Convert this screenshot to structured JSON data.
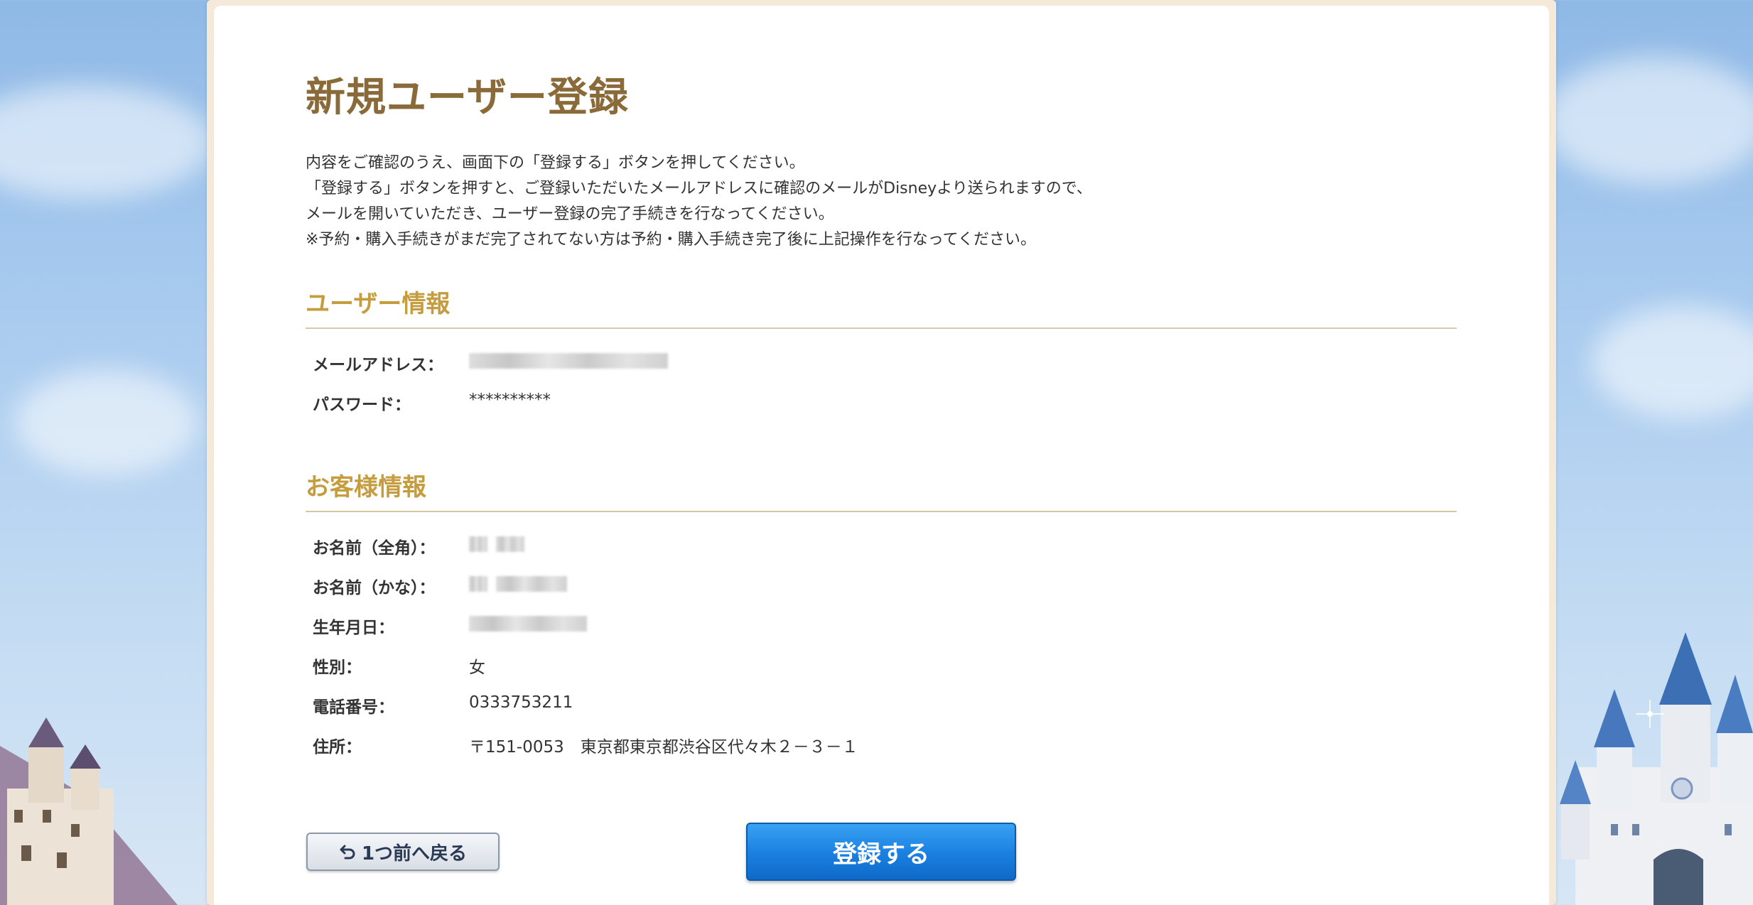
{
  "page": {
    "title": "新規ユーザー登録",
    "intro_lines": [
      "内容をご確認のうえ、画面下の「登録する」ボタンを押してください。",
      "「登録する」ボタンを押すと、ご登録いただいたメールアドレスに確認のメールがDisneyより送られますので、",
      "メールを開いていただき、ユーザー登録の完了手続きを行なってください。",
      "※予約・購入手続きがまだ完了されてない方は予約・購入手続き完了後に上記操作を行なってください。"
    ]
  },
  "user_info": {
    "heading": "ユーザー情報",
    "email_label": "メールアドレス：",
    "password_label": "パスワード：",
    "password_value": "**********"
  },
  "customer_info": {
    "heading": "お客様情報",
    "name_full_label": "お名前（全角）：",
    "name_kana_label": "お名前（かな）：",
    "birthdate_label": "生年月日：",
    "gender_label": "性別：",
    "gender_value": "女",
    "phone_label": "電話番号：",
    "phone_value": "0333753211",
    "address_label": "住所：",
    "address_value": "〒151-0053　東京都東京都渋谷区代々木２－３－１"
  },
  "actions": {
    "back_label": "1つ前へ戻る",
    "submit_label": "登録する"
  }
}
